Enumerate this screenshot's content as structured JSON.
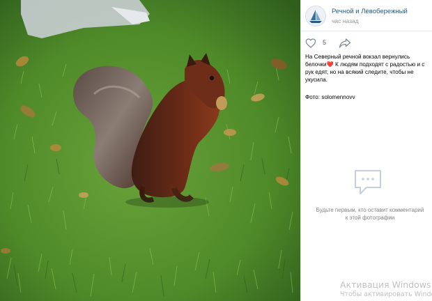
{
  "post": {
    "author_name": "Речной и Левобережный",
    "time": "час назад",
    "likes_count": "5",
    "caption_part1": "На Северный речной вокзал вернулись белочки",
    "caption_emoji": "❤️",
    "caption_part2": " К людям подходят с радостью и с рук едят, но на всякий следите, чтобы не укусила.",
    "photo_credit": "Фото: solomennovv"
  },
  "comments": {
    "empty_text": "Будьте первым, кто оставит комментарий к этой фотографии"
  },
  "icons": {
    "like": "heart-outline-icon",
    "share": "share-arrow-icon",
    "comments": "speech-bubble-icon",
    "avatar": "sailboat-logo"
  },
  "watermark": {
    "title": "Активация Windows",
    "subtitle": "Чтобы активировать Windo"
  },
  "colors": {
    "link": "#2a5885",
    "muted": "#939393",
    "heart": "#e0492b"
  }
}
